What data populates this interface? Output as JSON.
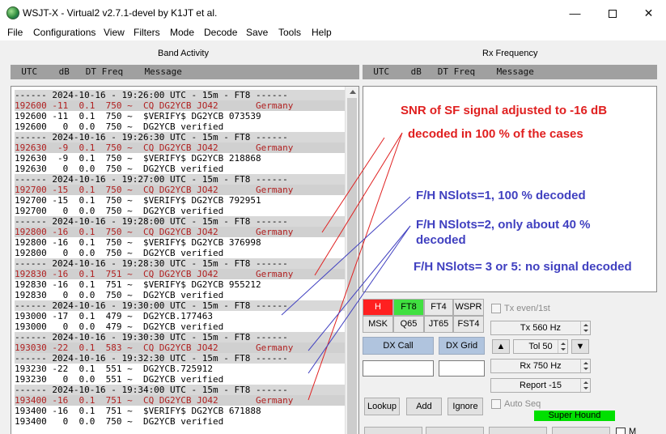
{
  "window": {
    "title": "WSJT-X - Virtual2   v2.7.1-devel   by K1JT et al.",
    "minimize": "—",
    "close": "✕"
  },
  "menu": [
    "File",
    "Configurations",
    "View",
    "Filters",
    "Mode",
    "Decode",
    "Save",
    "Tools",
    "Help"
  ],
  "band_activity": {
    "label": "Band Activity",
    "header": "  UTC    dB   DT Freq    Message",
    "lines": [
      {
        "text": "------ 2024-10-16 - 19:26:00 UTC - 15m - FT8 ------",
        "kind": "sep"
      },
      {
        "text": "192600 -11  0.1  750 ~  CQ DG2YCB JO42       Germany",
        "kind": "cq"
      },
      {
        "text": "192600 -11  0.1  750 ~  $VERIFY$ DG2YCB 073539",
        "kind": "plain"
      },
      {
        "text": "192600   0  0.0  750 ~  DG2YCB verified",
        "kind": "plain"
      },
      {
        "text": "------ 2024-10-16 - 19:26:30 UTC - 15m - FT8 ------",
        "kind": "sep"
      },
      {
        "text": "192630  -9  0.1  750 ~  CQ DG2YCB JO42       Germany",
        "kind": "cq"
      },
      {
        "text": "192630  -9  0.1  750 ~  $VERIFY$ DG2YCB 218868",
        "kind": "plain"
      },
      {
        "text": "192630   0  0.0  750 ~  DG2YCB verified",
        "kind": "plain"
      },
      {
        "text": "------ 2024-10-16 - 19:27:00 UTC - 15m - FT8 ------",
        "kind": "sep"
      },
      {
        "text": "192700 -15  0.1  750 ~  CQ DG2YCB JO42       Germany",
        "kind": "cq"
      },
      {
        "text": "192700 -15  0.1  750 ~  $VERIFY$ DG2YCB 792951",
        "kind": "plain"
      },
      {
        "text": "192700   0  0.0  750 ~  DG2YCB verified",
        "kind": "plain"
      },
      {
        "text": "------ 2024-10-16 - 19:28:00 UTC - 15m - FT8 ------",
        "kind": "sep"
      },
      {
        "text": "192800 -16  0.1  750 ~  CQ DG2YCB JO42       Germany",
        "kind": "cq"
      },
      {
        "text": "192800 -16  0.1  750 ~  $VERIFY$ DG2YCB 376998",
        "kind": "plain"
      },
      {
        "text": "192800   0  0.0  750 ~  DG2YCB verified",
        "kind": "plain"
      },
      {
        "text": "------ 2024-10-16 - 19:28:30 UTC - 15m - FT8 ------",
        "kind": "sep"
      },
      {
        "text": "192830 -16  0.1  751 ~  CQ DG2YCB JO42       Germany",
        "kind": "cq"
      },
      {
        "text": "192830 -16  0.1  751 ~  $VERIFY$ DG2YCB 955212",
        "kind": "plain"
      },
      {
        "text": "192830   0  0.0  750 ~  DG2YCB verified",
        "kind": "plain"
      },
      {
        "text": "------ 2024-10-16 - 19:30:00 UTC - 15m - FT8 ------",
        "kind": "sep"
      },
      {
        "text": "193000 -17  0.1  479 ~  DG2YCB.177463",
        "kind": "plain"
      },
      {
        "text": "193000   0  0.0  479 ~  DG2YCB verified",
        "kind": "plain"
      },
      {
        "text": "------ 2024-10-16 - 19:30:30 UTC - 15m - FT8 ------",
        "kind": "sep"
      },
      {
        "text": "193030 -22  0.1  583 ~  CQ DG2YCB JO42       Germany",
        "kind": "cq"
      },
      {
        "text": "------ 2024-10-16 - 19:32:30 UTC - 15m - FT8 ------",
        "kind": "sep"
      },
      {
        "text": "193230 -22  0.1  551 ~  DG2YCB.725912",
        "kind": "plain"
      },
      {
        "text": "193230   0  0.0  551 ~  DG2YCB verified",
        "kind": "plain"
      },
      {
        "text": "------ 2024-10-16 - 19:34:00 UTC - 15m - FT8 ------",
        "kind": "sep"
      },
      {
        "text": "193400 -16  0.1  751 ~  CQ DG2YCB JO42       Germany",
        "kind": "cq"
      },
      {
        "text": "193400 -16  0.1  751 ~  $VERIFY$ DG2YCB 671888",
        "kind": "plain"
      },
      {
        "text": "193400   0  0.0  750 ~  DG2YCB verified",
        "kind": "plain"
      }
    ]
  },
  "rx_frequency": {
    "label": "Rx Frequency",
    "header": "  UTC    dB   DT Freq    Message"
  },
  "annotations": {
    "line1": "SNR of SF signal adjusted to -16 dB",
    "line2": "decoded in 100 % of the cases",
    "nslots1": "F/H NSlots=1, 100 % decoded",
    "nslots2_a": "F/H NSlots=2, only about 40 %",
    "nslots2_b": "decoded",
    "nslots3": "F/H NSlots= 3 or 5: no signal decoded"
  },
  "controls": {
    "modes_row1": [
      "H",
      "FT8",
      "FT4",
      "WSPR"
    ],
    "modes_row2": [
      "MSK",
      "Q65",
      "JT65",
      "FST4"
    ],
    "tx_even": "Tx even/1st",
    "tx_freq": "Tx  560  Hz",
    "dx_call": "DX Call",
    "dx_grid": "DX Grid",
    "tol": "Tol  50",
    "rx_freq": "Rx  750  Hz",
    "report": "Report -15",
    "lookup": "Lookup",
    "add": "Add",
    "ignore": "Ignore",
    "auto_seq": "Auto Seq",
    "super_hound": "Super Hound",
    "up_arrow": "▲",
    "down_arrow": "▼",
    "m_label": "M"
  },
  "colors": {
    "h_button": "#ff2020",
    "ft8_button": "#40e040",
    "super_hound": "#00e000",
    "cq_text": "#b02020",
    "note_red": "#e02020",
    "note_blue": "#4040c0",
    "dx_buttons": "#b0c4de"
  }
}
